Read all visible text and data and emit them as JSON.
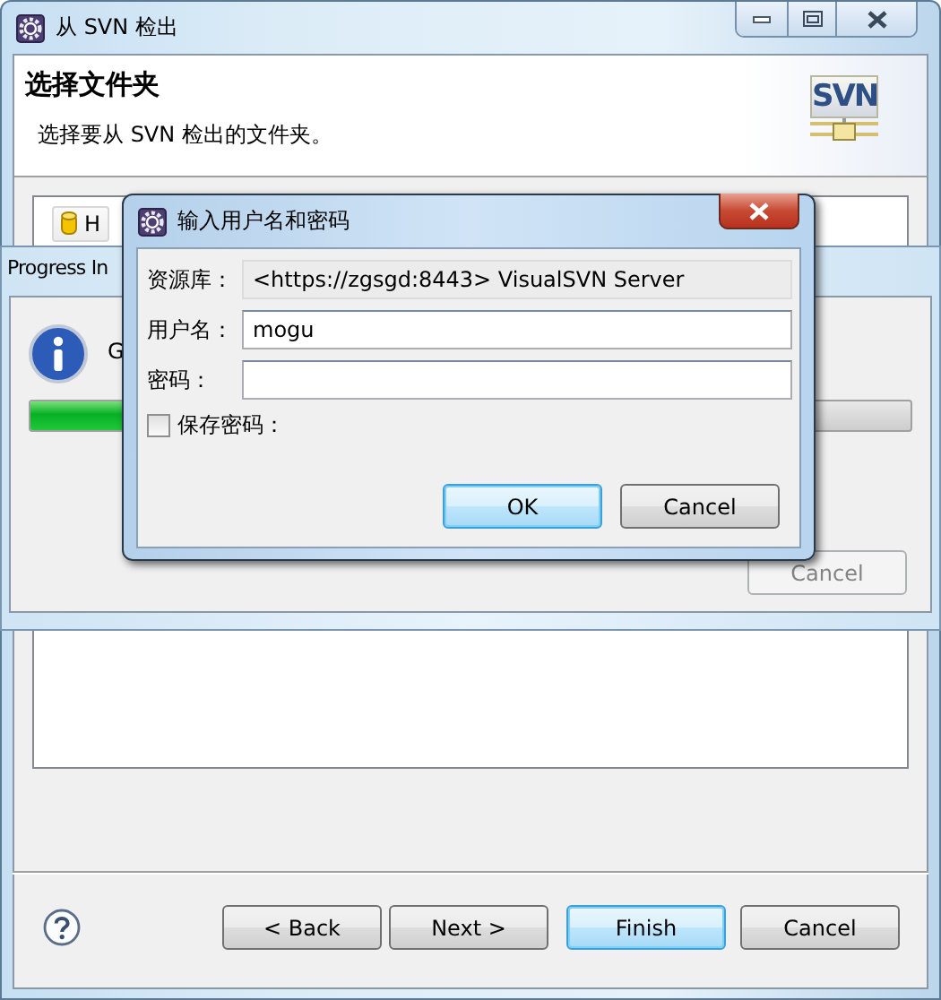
{
  "main_window": {
    "title": "从 SVN 检出",
    "header": {
      "title": "选择文件夹",
      "subtitle": "选择要从 SVN 检出的文件夹。",
      "logo": "SVN"
    },
    "tree": {
      "items": [
        {
          "label": "H"
        }
      ]
    },
    "buttons": [
      {
        "label": "< Back",
        "default": false,
        "disabled": false
      },
      {
        "label": "Next >",
        "default": false,
        "disabled": false
      },
      {
        "label": "Finish",
        "default": true,
        "disabled": false
      },
      {
        "label": "Cancel",
        "default": false,
        "disabled": false
      }
    ]
  },
  "progress_dialog": {
    "title": "Progress In",
    "message": "G",
    "progress": {
      "level": 0.25
    },
    "buttons": [
      {
        "label": "Cancel",
        "default": false,
        "disabled": true
      }
    ]
  },
  "login_dialog": {
    "title": "输入用户名和密码",
    "fields": [
      {
        "label": "资源库：",
        "value": "<https://zgsgd:8443> VisualSVN Server",
        "readonly": true
      },
      {
        "label": "用户名：",
        "value": "mogu",
        "readonly": false
      },
      {
        "label": "密码：",
        "readonly": false
      }
    ],
    "checkbox": {
      "label": "保存密码：",
      "checked": false
    },
    "buttons": [
      {
        "label": "OK",
        "default": true,
        "disabled": false
      },
      {
        "label": "Cancel",
        "default": false,
        "disabled": false
      }
    ]
  }
}
